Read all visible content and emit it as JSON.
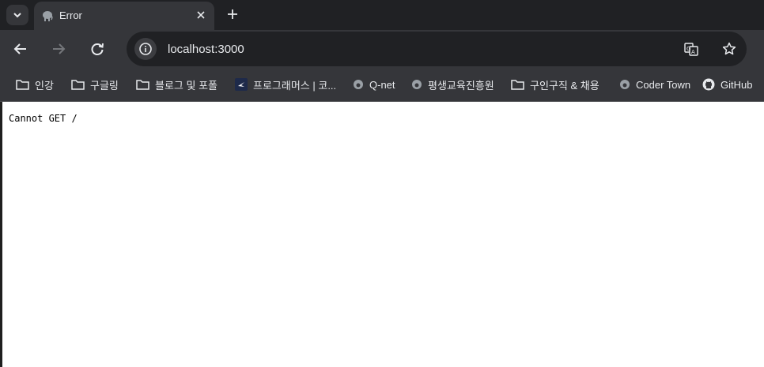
{
  "tab": {
    "title": "Error"
  },
  "toolbar": {
    "url": "localhost:3000"
  },
  "bookmarks": [
    {
      "label": "인강",
      "icon": "folder-icon"
    },
    {
      "label": "구글링",
      "icon": "folder-icon"
    },
    {
      "label": "블로그 및 포폴",
      "icon": "folder-icon"
    },
    {
      "label": "프로그래머스 | 코...",
      "icon": "programmers-icon"
    },
    {
      "label": "Q-net",
      "icon": "globe-icon"
    },
    {
      "label": "평생교육진흥원",
      "icon": "globe-icon"
    },
    {
      "label": "구인구직 & 채용",
      "icon": "folder-icon"
    },
    {
      "label": "Coder Town",
      "icon": "globe-icon"
    },
    {
      "label": "GitHub",
      "icon": "github-icon"
    }
  ],
  "page": {
    "message": "Cannot GET /"
  }
}
